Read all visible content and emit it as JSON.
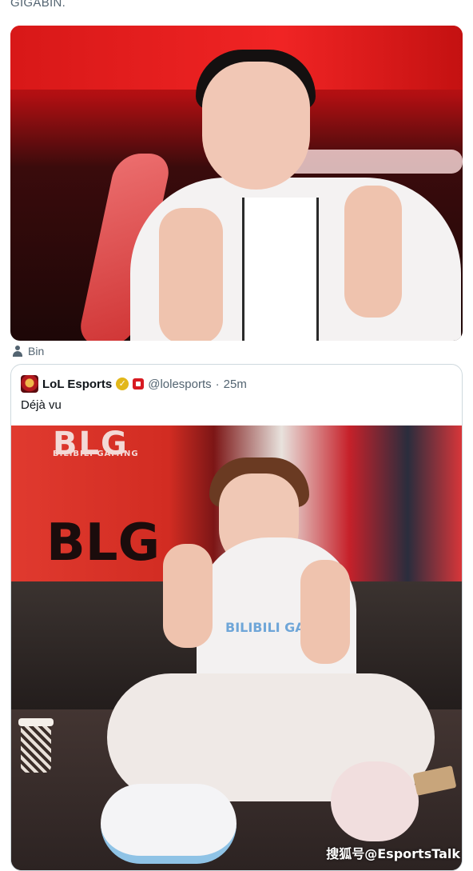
{
  "top_text": "GIGABIN.",
  "media": {
    "photo1_credit": "Bin"
  },
  "quoted_tweet": {
    "author_name": "LoL Esports",
    "handle": "@lolesports",
    "separator": "·",
    "time": "25m",
    "text": "Déjà vu",
    "image_text": {
      "banner_logo": "BLG",
      "banner_sub": "BILIBILI GAMING",
      "banner_big": "BLG",
      "shirt_text": "BILIBILI GAMING"
    }
  },
  "watermark": "搜狐号@EsportsTalk",
  "colors": {
    "verified": "#e2b719",
    "affiliate": "#d71a21",
    "secondary_text": "#536471",
    "border": "#cfd9de"
  },
  "icons": [
    "person-icon",
    "verified-badge-icon",
    "affiliate-badge-icon"
  ]
}
